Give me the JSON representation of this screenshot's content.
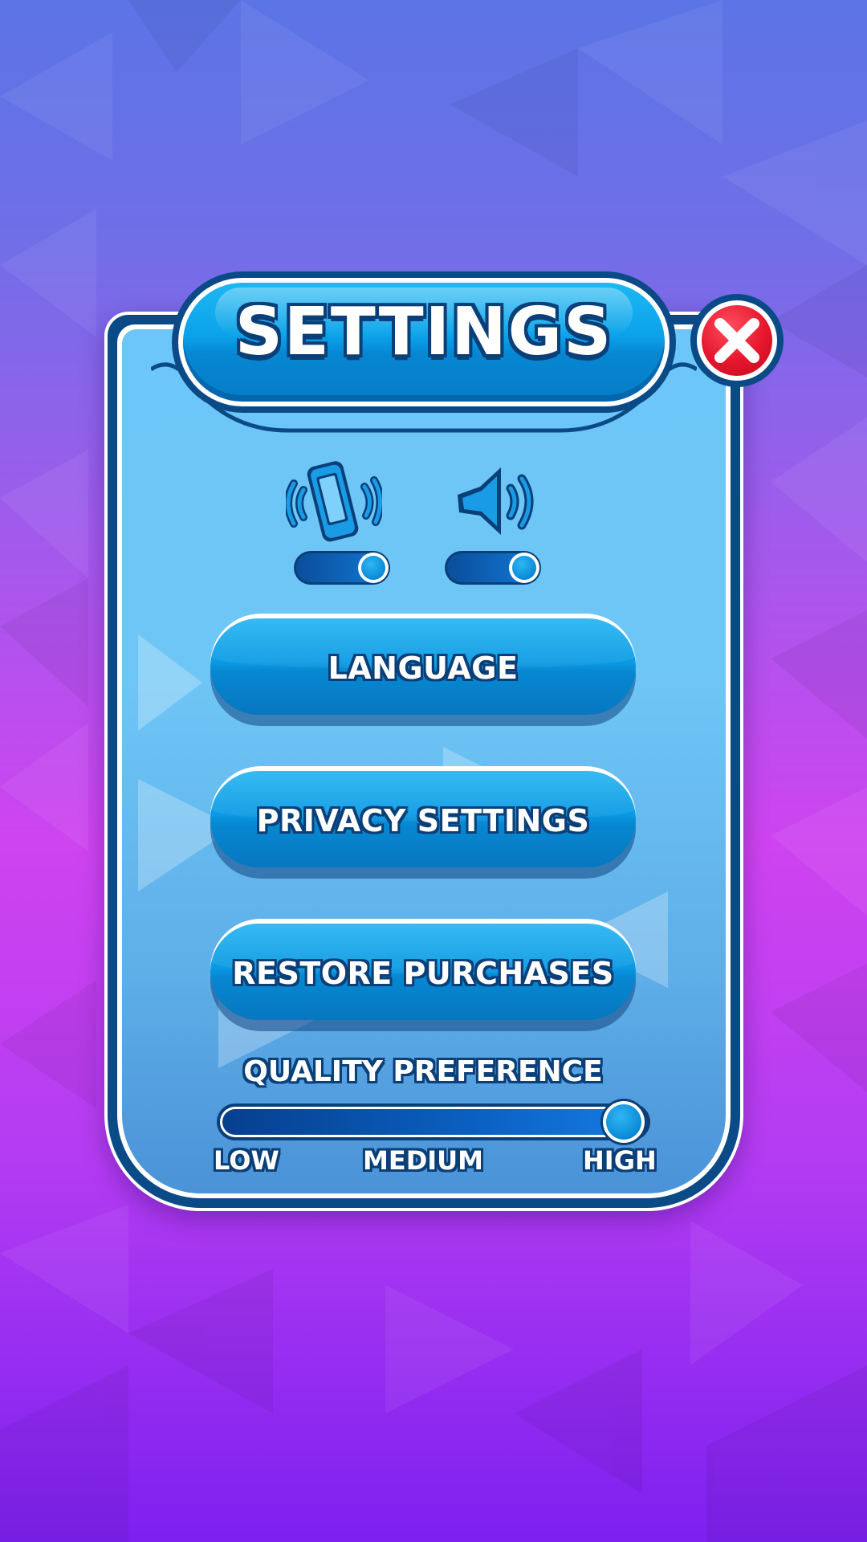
{
  "title": "SETTINGS",
  "toggles": {
    "vibration": {
      "icon": "phone-vibrate-icon",
      "on": true
    },
    "sound": {
      "icon": "speaker-icon",
      "on": true
    }
  },
  "buttons": {
    "language": "LANGUAGE",
    "privacy": "PRIVACY SETTINGS",
    "restore": "RESTORE PURCHASES"
  },
  "quality": {
    "title": "QUALITY PREFERENCE",
    "low": "LOW",
    "medium": "MEDIUM",
    "high": "HIGH",
    "value_fraction": 1.0
  },
  "colors": {
    "accent": "#0a9ae4",
    "outline": "#0a3f78",
    "close": "#e5162d"
  }
}
